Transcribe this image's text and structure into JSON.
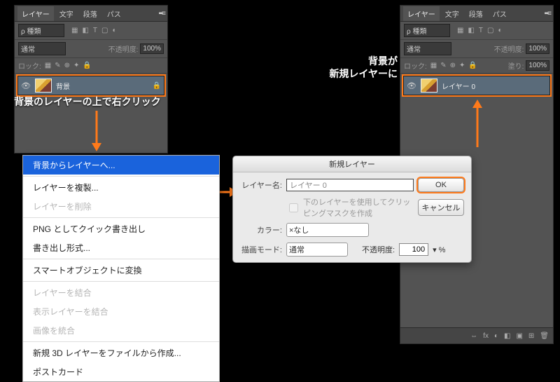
{
  "tabs": {
    "layer": "レイヤー",
    "text": "文字",
    "para": "段落",
    "path": "パス"
  },
  "filter": {
    "label": "ρ 種類",
    "icons": [
      "▦",
      "◧",
      "T",
      "▢",
      "◐"
    ]
  },
  "blend": {
    "mode": "通常",
    "opacityLabel": "不透明度:",
    "opacity": "100%"
  },
  "lock": {
    "label": "ロック:",
    "icons": [
      "▦",
      "✎",
      "⊕",
      "✦",
      "🔒"
    ],
    "fillLabel": "塗り:",
    "fill": "100%"
  },
  "layerLeft": {
    "name": "背景"
  },
  "layerRight": {
    "name": "レイヤー 0"
  },
  "anno": {
    "rightclick": "背景のレイヤーの上で右クリック",
    "backgroundBecomes": "背景が",
    "newLayer": "新規レイヤーに"
  },
  "ctx": {
    "i1": "背景からレイヤーへ...",
    "i2": "レイヤーを複製...",
    "i3": "レイヤーを削除",
    "i4": "PNG としてクイック書き出し",
    "i5": "書き出し形式...",
    "i6": "スマートオブジェクトに変換",
    "i7": "レイヤーを結合",
    "i8": "表示レイヤーを結合",
    "i9": "画像を統合",
    "i10": "新規 3D レイヤーをファイルから作成...",
    "i11": "ポストカード"
  },
  "dlg": {
    "title": "新規レイヤー",
    "nameLabel": "レイヤー名:",
    "nameValue": "レイヤー 0",
    "ok": "OK",
    "cancel": "キャンセル",
    "clip": "下のレイヤーを使用してクリッピングマスクを作成",
    "colorLabel": "カラー:",
    "colorValue": "×なし",
    "blendLabel": "描画モード:",
    "blendValue": "通常",
    "opLabel": "不透明度:",
    "opValue": "100",
    "opUnit": "%"
  },
  "footerIcons": [
    "⇔",
    "fx",
    "◐",
    "◧",
    "▣",
    "⊞",
    "🗑"
  ]
}
